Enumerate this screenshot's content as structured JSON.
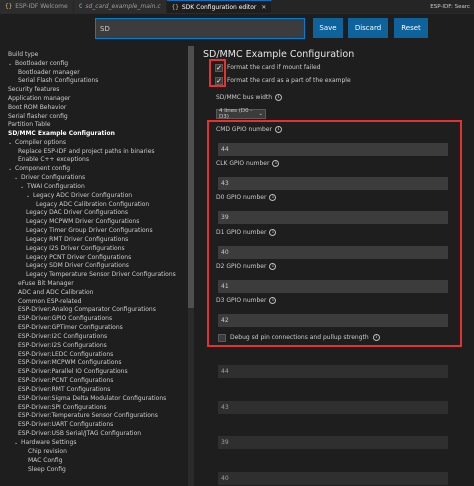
{
  "tabs": [
    {
      "icon": "{}",
      "label": "ESP-IDF Welcome",
      "active": false,
      "italic": false
    },
    {
      "icon": "C",
      "label": "sd_card_example_main.c",
      "active": false,
      "italic": true
    },
    {
      "icon": "{}",
      "label": "SDK Configuration editor",
      "active": true,
      "italic": false
    }
  ],
  "tabbar_right": "ESP-IDF: Searc",
  "search": {
    "value": "SD",
    "placeholder": ""
  },
  "buttons": {
    "save": "Save",
    "discard": "Discard",
    "reset": "Reset"
  },
  "sidebar": {
    "items": [
      {
        "label": "Build type",
        "chevron": false,
        "bold": false
      },
      {
        "label": "Bootloader config",
        "chevron": true,
        "bold": false
      },
      {
        "label": "Bootloader manager",
        "chevron": false,
        "bold": false
      },
      {
        "label": "Serial Flash Configurations",
        "chevron": false,
        "bold": false
      },
      {
        "label": "Security features",
        "chevron": false,
        "bold": false
      },
      {
        "label": "Application manager",
        "chevron": false,
        "bold": false
      },
      {
        "label": "Boot ROM Behavior",
        "chevron": false,
        "bold": false
      },
      {
        "label": "Serial flasher config",
        "chevron": false,
        "bold": false
      },
      {
        "label": "Partition Table",
        "chevron": false,
        "bold": false
      },
      {
        "label": "SD/MMC Example Configuration",
        "chevron": false,
        "bold": true
      },
      {
        "label": "Compiler options",
        "chevron": true,
        "bold": false
      },
      {
        "label": "Replace ESP-IDF and project paths in binaries",
        "chevron": false,
        "bold": false
      },
      {
        "label": "Enable C++ exceptions",
        "chevron": false,
        "bold": false
      },
      {
        "label": "Component config",
        "chevron": true,
        "bold": false
      },
      {
        "label": "Driver Configurations",
        "chevron": true,
        "bold": false
      },
      {
        "label": "TWAI Configuration",
        "chevron": true,
        "bold": false
      },
      {
        "label": "Legacy ADC Driver Configuration",
        "chevron": true,
        "bold": false
      },
      {
        "label": "Legacy ADC Calibration Configuration",
        "chevron": false,
        "bold": false
      },
      {
        "label": "Legacy DAC Driver Configurations",
        "chevron": false,
        "bold": false
      },
      {
        "label": "Legacy MCPWM Driver Configurations",
        "chevron": false,
        "bold": false
      },
      {
        "label": "Legacy Timer Group Driver Configurations",
        "chevron": false,
        "bold": false
      },
      {
        "label": "Legacy RMT Driver Configurations",
        "chevron": false,
        "bold": false
      },
      {
        "label": "Legacy I2S Driver Configurations",
        "chevron": false,
        "bold": false
      },
      {
        "label": "Legacy PCNT Driver Configurations",
        "chevron": false,
        "bold": false
      },
      {
        "label": "Legacy SDM Driver Configurations",
        "chevron": false,
        "bold": false
      },
      {
        "label": "Legacy Temperature Sensor Driver Configurations",
        "chevron": false,
        "bold": false
      },
      {
        "label": "eFuse Bit Manager",
        "chevron": false,
        "bold": false
      },
      {
        "label": "ADC and ADC Calibration",
        "chevron": false,
        "bold": false
      },
      {
        "label": "Common ESP-related",
        "chevron": false,
        "bold": false
      },
      {
        "label": "ESP-Driver:Analog Comparator Configurations",
        "chevron": false,
        "bold": false
      },
      {
        "label": "ESP-Driver:GPIO Configurations",
        "chevron": false,
        "bold": false
      },
      {
        "label": "ESP-Driver:GPTimer Configurations",
        "chevron": false,
        "bold": false
      },
      {
        "label": "ESP-Driver:I2C Configurations",
        "chevron": false,
        "bold": false
      },
      {
        "label": "ESP-Driver:I2S Configurations",
        "chevron": false,
        "bold": false
      },
      {
        "label": "ESP-Driver:LEDC Configurations",
        "chevron": false,
        "bold": false
      },
      {
        "label": "ESP-Driver:MCPWM Configurations",
        "chevron": false,
        "bold": false
      },
      {
        "label": "ESP-Driver:Parallel IO Configurations",
        "chevron": false,
        "bold": false
      },
      {
        "label": "ESP-Driver:PCNT Configurations",
        "chevron": false,
        "bold": false
      },
      {
        "label": "ESP-Driver:RMT Configurations",
        "chevron": false,
        "bold": false
      },
      {
        "label": "ESP-Driver:Sigma Delta Modulator Configurations",
        "chevron": false,
        "bold": false
      },
      {
        "label": "ESP-Driver:SPI Configurations",
        "chevron": false,
        "bold": false
      },
      {
        "label": "ESP-Driver:Temperature Sensor Configurations",
        "chevron": false,
        "bold": false
      },
      {
        "label": "ESP-Driver:UART Configurations",
        "chevron": false,
        "bold": false
      },
      {
        "label": "ESP-Driver:USB Serial/JTAG Configuration",
        "chevron": false,
        "bold": false
      },
      {
        "label": "Hardware Settings",
        "chevron": true,
        "bold": false
      },
      {
        "label": "Chip revision",
        "chevron": false,
        "bold": false
      },
      {
        "label": "MAC Config",
        "chevron": false,
        "bold": false
      },
      {
        "label": "Sleep Config",
        "chevron": false,
        "bold": false
      }
    ]
  },
  "main": {
    "title": "SD/MMC Example Configuration",
    "checkboxes": [
      {
        "label": "Format the card if mount failed",
        "checked": true
      },
      {
        "label": "Format the card as a part of the example",
        "checked": true
      }
    ],
    "bus_width": {
      "label": "SD/MMC bus width",
      "value": "4 lines (D0 - D3)"
    },
    "gpio_fields": [
      {
        "label": "CMD GPIO number",
        "value": "44"
      },
      {
        "label": "CLK GPIO number",
        "value": "43"
      },
      {
        "label": "D0 GPIO number",
        "value": "39"
      },
      {
        "label": "D1 GPIO number",
        "value": "40"
      },
      {
        "label": "D2 GPIO number",
        "value": "41"
      },
      {
        "label": "D3 GPIO number",
        "value": "42"
      }
    ],
    "debug_checkbox": {
      "label": "Debug sd pin connections and pullup strength",
      "checked": false
    },
    "lower_values": [
      "44",
      "43",
      "39",
      "40"
    ]
  },
  "colors": {
    "accent": "#0e639c",
    "highlight": "#e5312f",
    "background": "#1e1e1e"
  }
}
